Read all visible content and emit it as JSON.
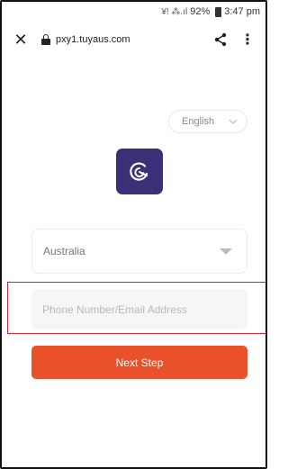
{
  "status_bar": {
    "signal_text": "¥! ⁂.ıl",
    "battery": "92%",
    "time": "3:47 pm"
  },
  "browser": {
    "close_label": "✕",
    "url": "pxy1.tuyaus.com",
    "menu_label": "⋮"
  },
  "page": {
    "language": "English",
    "country": "Australia",
    "phone_placeholder": "Phone Number/Email Address",
    "next_button_label": "Next Step"
  },
  "colors": {
    "logo_bg": "#3b2f78",
    "primary_button": "#e9512a",
    "highlight_border": "#d9232e"
  },
  "icons": {
    "close": "close-icon",
    "lock": "lock-icon",
    "share": "share-icon",
    "menu": "more-vertical-icon",
    "chevron": "chevron-down-icon",
    "logo": "smart-life-logo-icon"
  }
}
